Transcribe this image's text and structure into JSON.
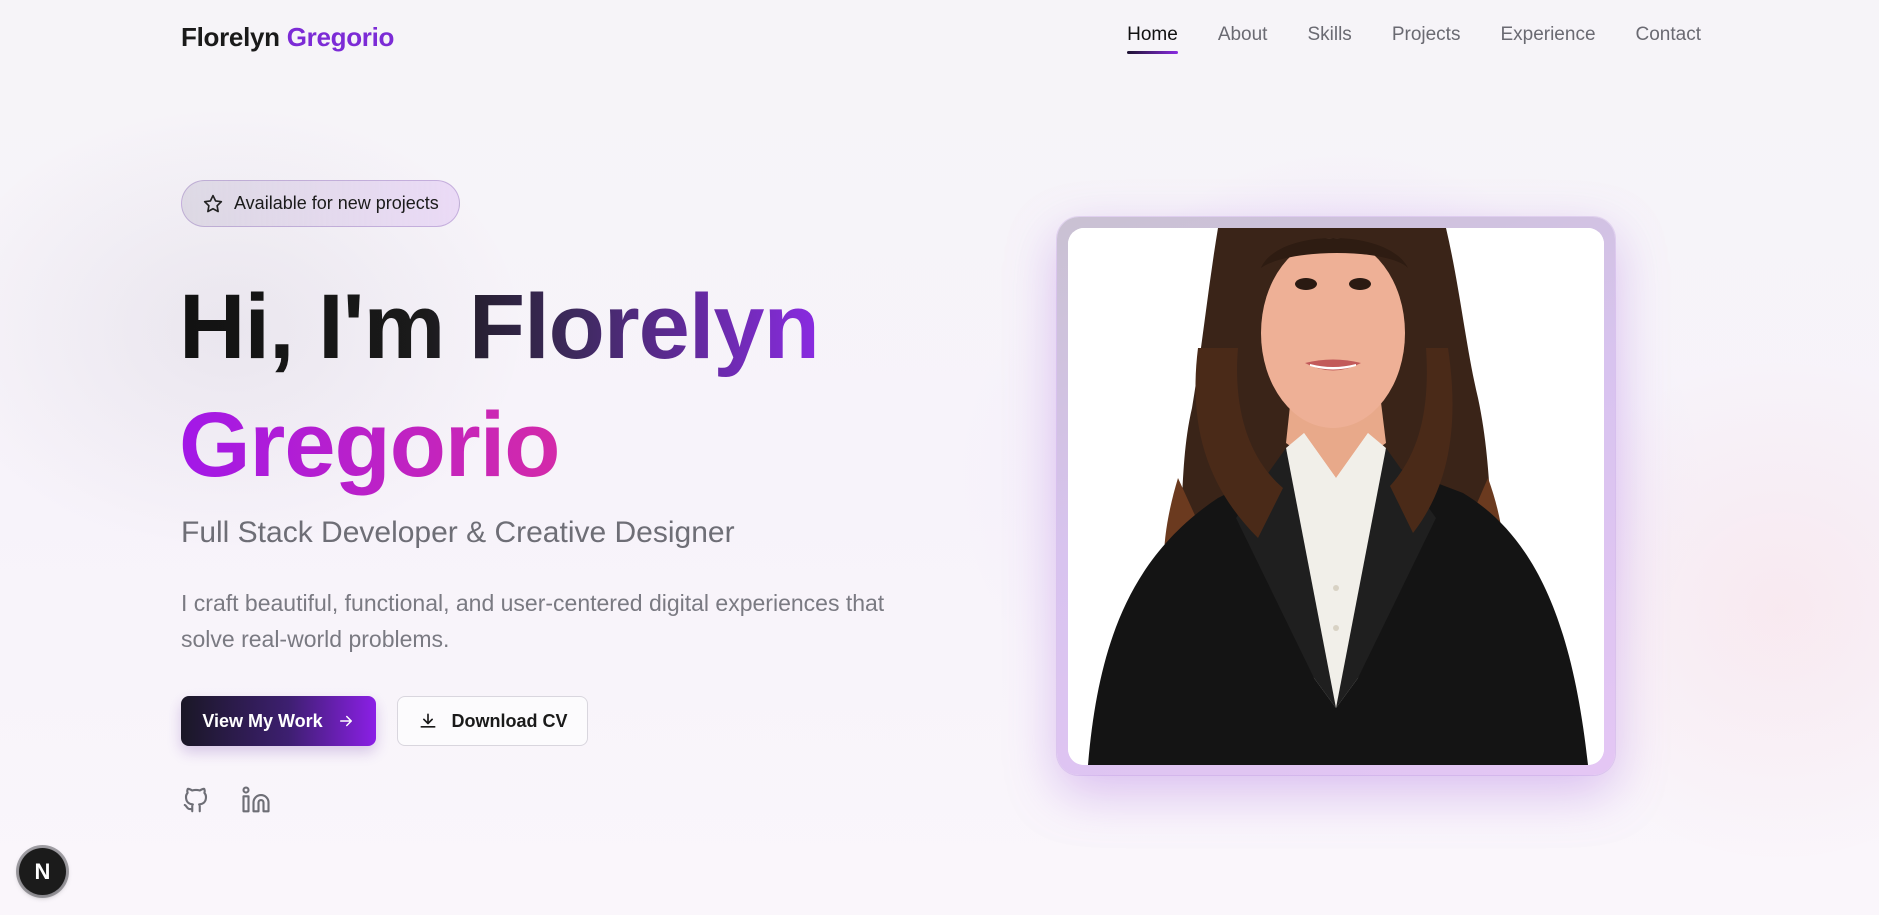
{
  "header": {
    "logo_first": "Florelyn",
    "logo_last": "Gregorio",
    "nav": [
      {
        "label": "Home",
        "active": true
      },
      {
        "label": "About"
      },
      {
        "label": "Skills"
      },
      {
        "label": "Projects"
      },
      {
        "label": "Experience"
      },
      {
        "label": "Contact"
      }
    ]
  },
  "hero": {
    "badge": {
      "icon": "star-icon",
      "text": "Available for new projects"
    },
    "headline_line1": "Hi, I'm Florelyn",
    "headline_line2": "Gregorio",
    "subtitle": "Full Stack Developer & Creative Designer",
    "description": "I craft beautiful, functional, and user-centered digital experiences that solve real-world problems.",
    "primary_button": {
      "label": "View My Work",
      "icon": "arrow-right-icon"
    },
    "secondary_button": {
      "label": "Download CV",
      "icon": "download-icon"
    },
    "socials": [
      {
        "name": "github",
        "icon": "github-icon"
      },
      {
        "name": "linkedin",
        "icon": "linkedin-icon"
      }
    ]
  },
  "portrait": {
    "alt": "Florelyn Gregorio portrait"
  },
  "dev_badge": {
    "letter": "N"
  },
  "colors": {
    "accent": "#7c2bd6",
    "gradient_purple": "#a218e8",
    "gradient_pink": "#ec1a78",
    "button_dark": "#1a1726"
  }
}
